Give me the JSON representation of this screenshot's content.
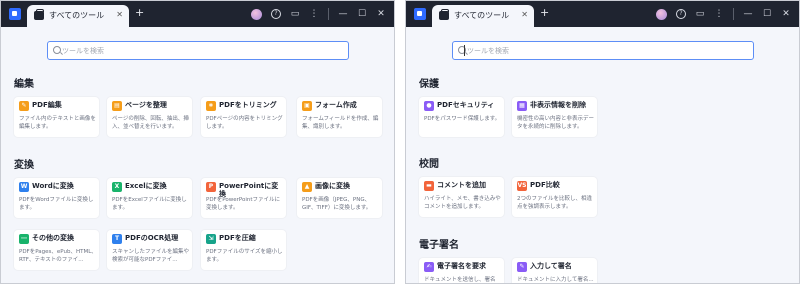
{
  "left_window": {
    "tab_label": "すべてのツール",
    "search_placeholder": "ツールを検索",
    "sections": [
      {
        "title": "編集",
        "cards": [
          {
            "title": "PDF編集",
            "desc": "ファイル内のテキストと画像を編集します。",
            "icon": "edit-icon",
            "color": "orange"
          },
          {
            "title": "ページを整理",
            "desc": "ページの削除、回転、抽出、挿入、並べ替えを行います。",
            "icon": "organize-icon",
            "color": "orange"
          },
          {
            "title": "PDFをトリミング",
            "desc": "PDFページの内容をトリミングします。",
            "icon": "crop-icon",
            "color": "orange"
          },
          {
            "title": "フォーム作成",
            "desc": "フォームフィールドを作成、編集、識別します。",
            "icon": "form-icon",
            "color": "orange"
          }
        ]
      },
      {
        "title": "変換",
        "cards": [
          {
            "title": "Wordに変換",
            "desc": "PDFをWordファイルに変換します。",
            "icon": "word-icon",
            "color": "blue"
          },
          {
            "title": "Excelに変換",
            "desc": "PDFをExcelファイルに変換します。",
            "icon": "excel-icon",
            "color": "green"
          },
          {
            "title": "PowerPointに変換",
            "desc": "PDFをPowerPointファイルに変換します。",
            "icon": "powerpoint-icon",
            "color": "red"
          },
          {
            "title": "画像に変換",
            "desc": "PDFを画像（JPEG、PNG、GIF、TIFF）に変換します。",
            "icon": "image-icon",
            "color": "orange"
          },
          {
            "title": "その他の変換",
            "desc": "PDFをPages、ePub、HTML、RTF、テキストのファイ...",
            "icon": "more-convert-icon",
            "color": "green"
          },
          {
            "title": "PDFのOCR処理",
            "desc": "スキャンしたファイルを編集や検索が可能なPDFファイ...",
            "icon": "ocr-icon",
            "color": "blue"
          },
          {
            "title": "PDFを圧縮",
            "desc": "PDFファイルのサイズを縮小します。",
            "icon": "compress-icon",
            "color": "teal"
          }
        ]
      }
    ]
  },
  "right_window": {
    "tab_label": "すべてのツール",
    "search_placeholder": "ツールを検索",
    "sections": [
      {
        "title": "保護",
        "cards": [
          {
            "title": "PDFセキュリティ",
            "desc": "PDFをパスワード保護します。",
            "icon": "lock-icon",
            "color": "purple"
          },
          {
            "title": "非表示情報を削除",
            "desc": "機密性の高い内容と非表示データを永続的に削除します。",
            "icon": "redact-icon",
            "color": "purple"
          }
        ]
      },
      {
        "title": "校閲",
        "cards": [
          {
            "title": "コメントを追加",
            "desc": "ハイライト、メモ、書き込みやコメントを追加します。",
            "icon": "comment-icon",
            "color": "red"
          },
          {
            "title": "PDF比較",
            "desc": "2つのファイルを比較し、相違点を強調表示します。",
            "icon": "compare-icon",
            "color": "red"
          }
        ]
      },
      {
        "title": "電子署名",
        "cards": [
          {
            "title": "電子署名を要求",
            "desc": "ドキュメントを送信し、署名を...",
            "icon": "request-sign-icon",
            "color": "purple"
          },
          {
            "title": "入力して署名",
            "desc": "ドキュメントに入力して署名...",
            "icon": "fill-sign-icon",
            "color": "purple"
          }
        ]
      }
    ]
  }
}
